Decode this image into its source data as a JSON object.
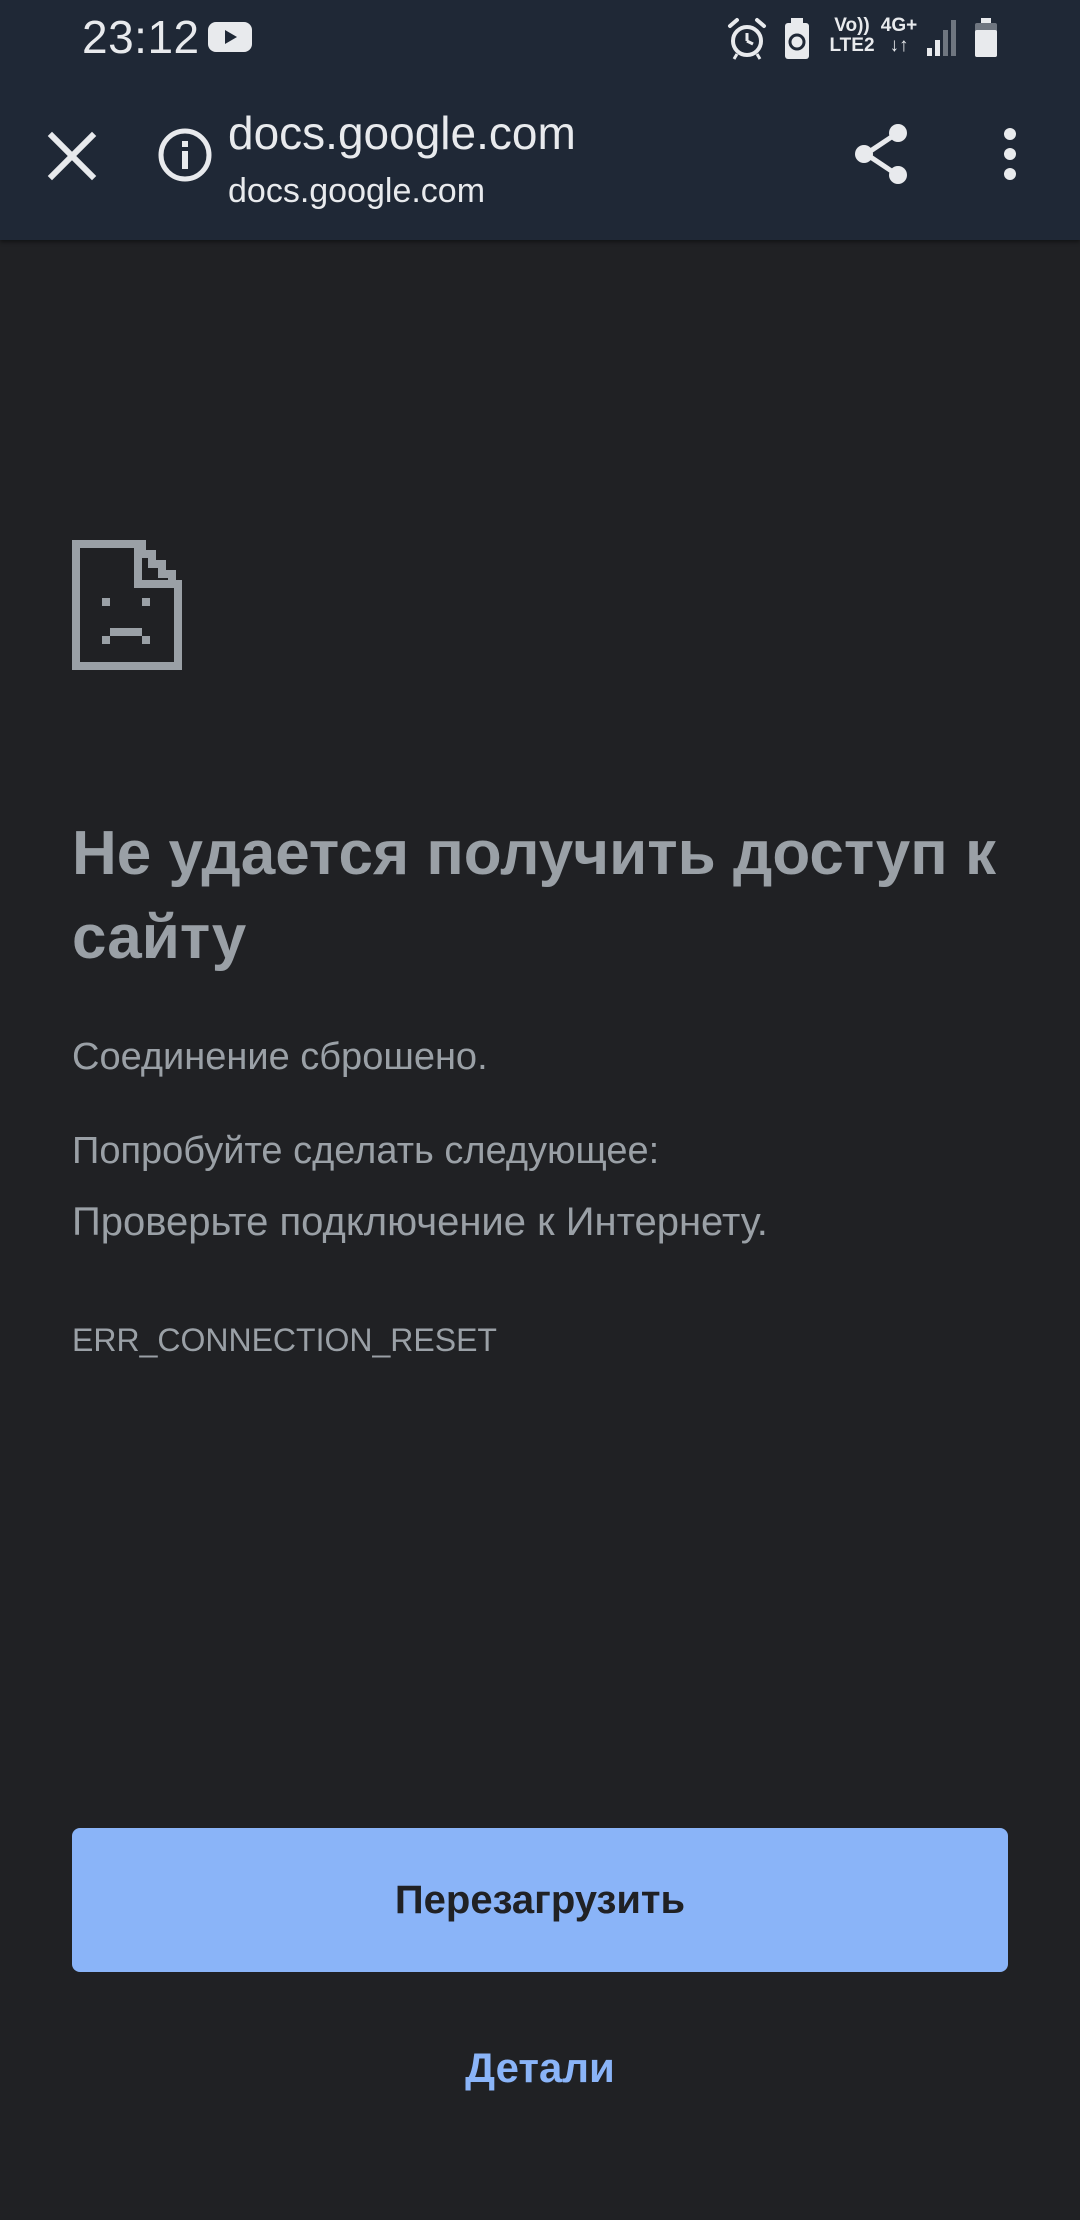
{
  "status_bar": {
    "time": "23:12",
    "volte_line1": "Vo))",
    "volte_line2": "LTE2",
    "network_line1": "4G+",
    "network_line2": "↓↑",
    "icons": [
      "youtube-icon",
      "alarm-icon",
      "battery-saver-icon",
      "signal-icon",
      "battery-icon"
    ]
  },
  "toolbar": {
    "title": "docs.google.com",
    "url": "docs.google.com",
    "icons": [
      "close-icon",
      "info-icon",
      "share-icon",
      "more-vert-icon"
    ]
  },
  "error_page": {
    "icon": "sad-document-icon",
    "heading": "Не удается получить доступ к сайту",
    "reason": "Соединение сброшено.",
    "suggestions_title": "Попробуйте сделать следующее:",
    "suggestion": "Проверьте подключение к Интернету.",
    "error_code": "ERR_CONNECTION_RESET",
    "reload_label": "Перезагрузить",
    "details_label": "Детали"
  },
  "colors": {
    "background": "#202124",
    "toolbar": "#1f2836",
    "text_secondary": "#9aa0a6",
    "accent": "#8ab4f8"
  }
}
